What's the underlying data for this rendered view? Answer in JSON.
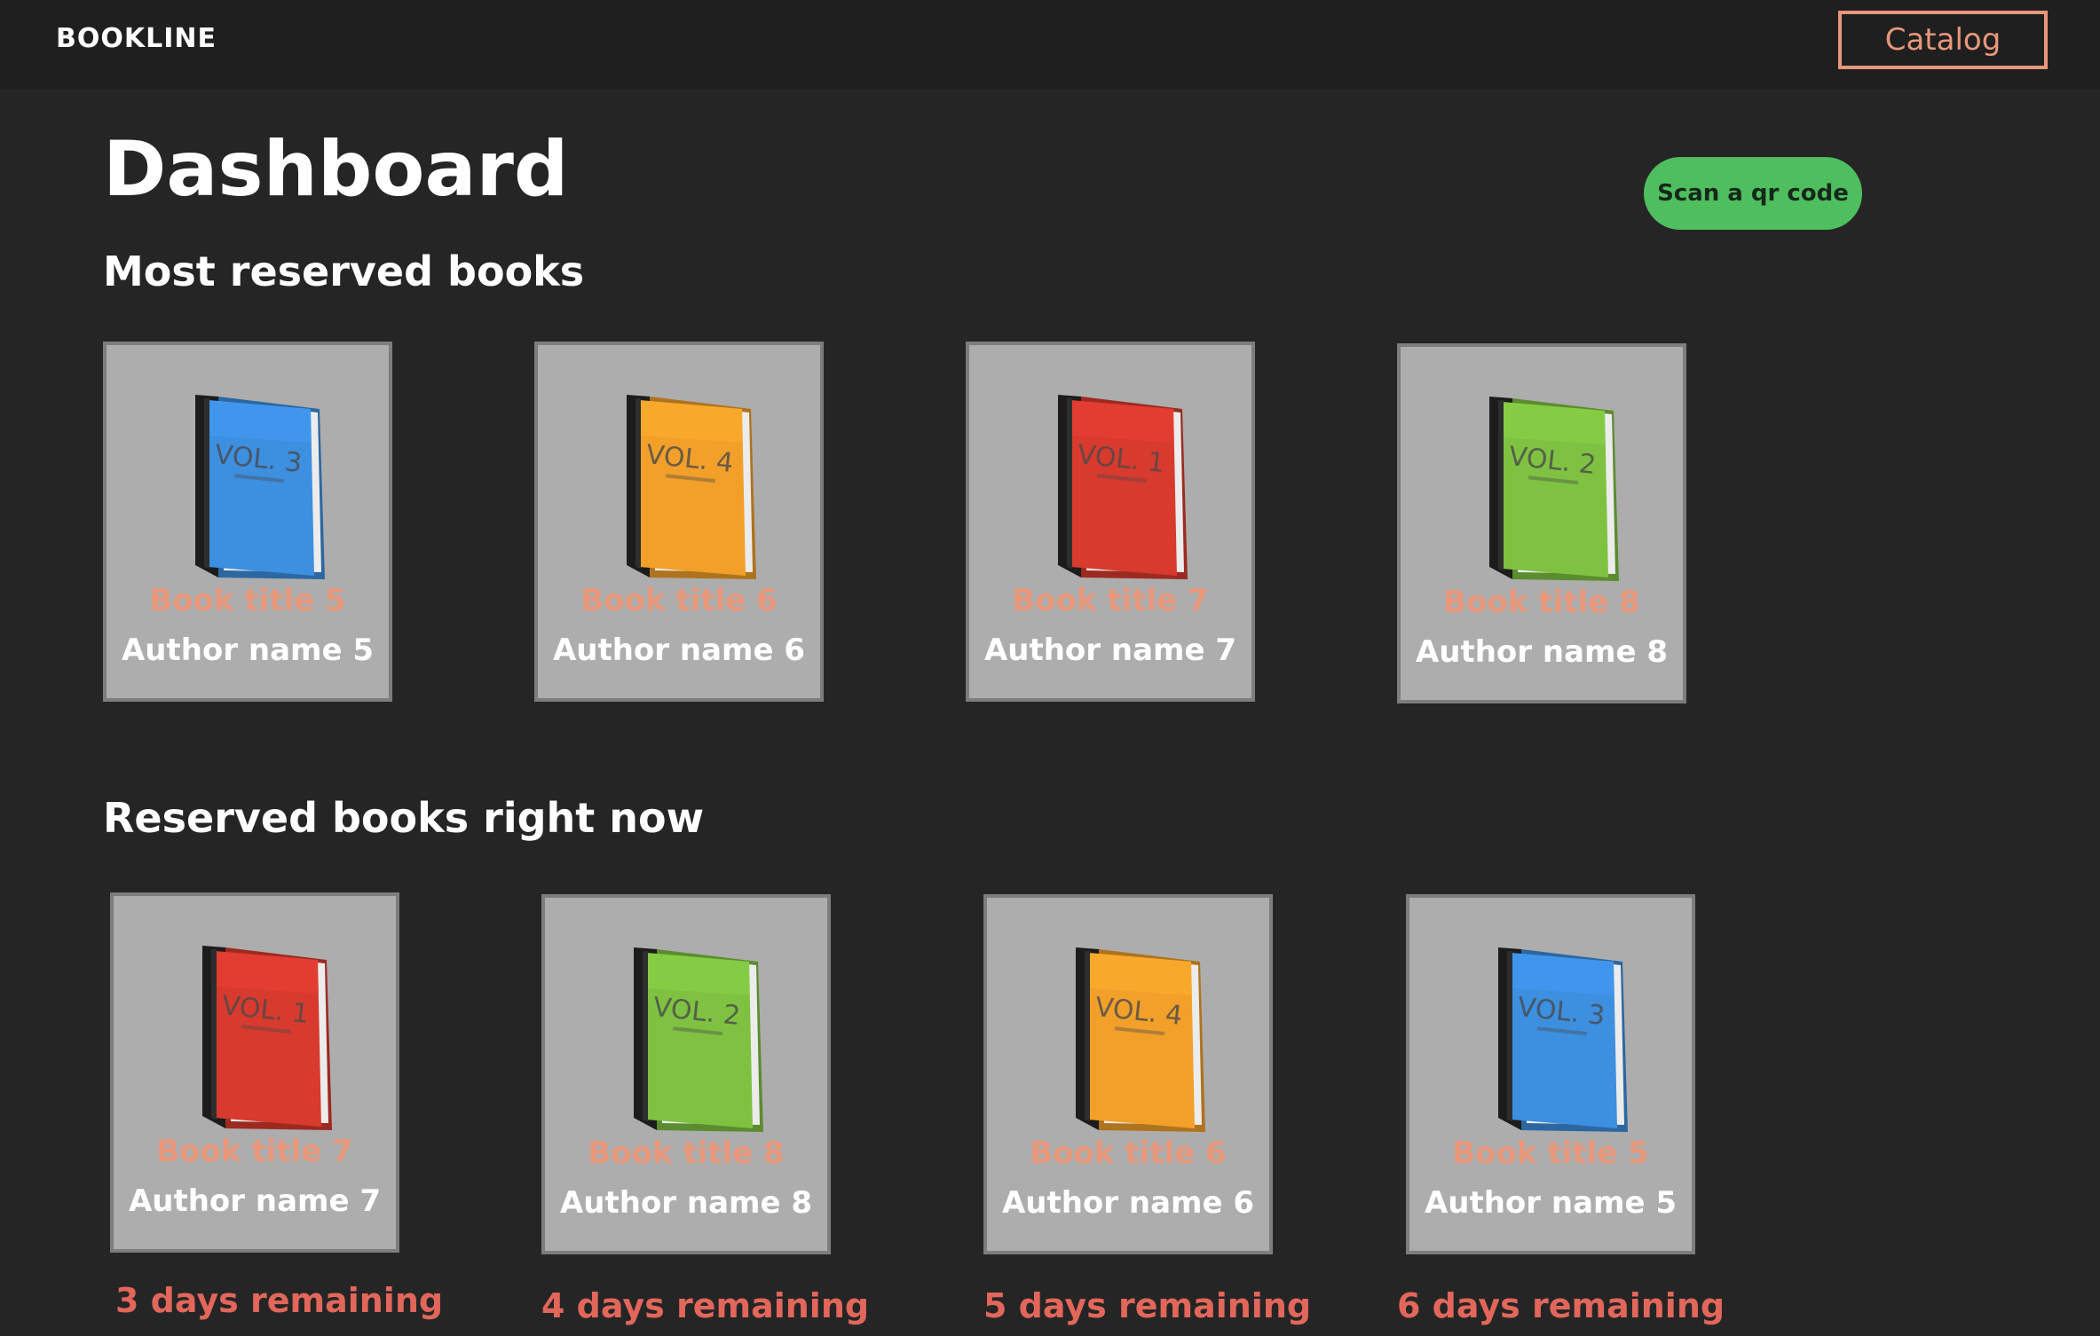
{
  "header": {
    "brand": "BOOKLINE",
    "catalog_label": "Catalog",
    "accent_color": "#e8977a"
  },
  "main": {
    "title": "Dashboard",
    "scan_button_label": "Scan a qr code",
    "scan_button_color": "#4fbe5e",
    "most_reserved": {
      "heading": "Most reserved books",
      "books": [
        {
          "title": "Book title 5",
          "author": "Author name 5",
          "cover_color": "#3d8fe0",
          "cover_label": "VOL. 3",
          "icon": "book-blue-icon"
        },
        {
          "title": "Book title 6",
          "author": "Author name 6",
          "cover_color": "#f2a02a",
          "cover_label": "VOL. 4",
          "icon": "book-orange-icon"
        },
        {
          "title": "Book title 7",
          "author": "Author name 7",
          "cover_color": "#d83a2e",
          "cover_label": "VOL. 1",
          "icon": "book-red-icon"
        },
        {
          "title": "Book title 8",
          "author": "Author name 8",
          "cover_color": "#7fc241",
          "cover_label": "VOL. 2",
          "icon": "book-green-icon"
        }
      ]
    },
    "reserved_now": {
      "heading": "Reserved books right now",
      "books": [
        {
          "title": "Book title 7",
          "author": "Author name 7",
          "remaining": "3 days remaining",
          "cover_color": "#d83a2e",
          "cover_label": "VOL. 1",
          "icon": "book-red-icon"
        },
        {
          "title": "Book title 8",
          "author": "Author name 8",
          "remaining": "4 days remaining",
          "cover_color": "#7fc241",
          "cover_label": "VOL. 2",
          "icon": "book-green-icon"
        },
        {
          "title": "Book title 6",
          "author": "Author name 6",
          "remaining": "5 days remaining",
          "cover_color": "#f2a02a",
          "cover_label": "VOL. 4",
          "icon": "book-orange-icon"
        },
        {
          "title": "Book title 5",
          "author": "Author name 5",
          "remaining": "6 days remaining",
          "cover_color": "#3d8fe0",
          "cover_label": "VOL. 3",
          "icon": "book-blue-icon"
        }
      ]
    }
  }
}
